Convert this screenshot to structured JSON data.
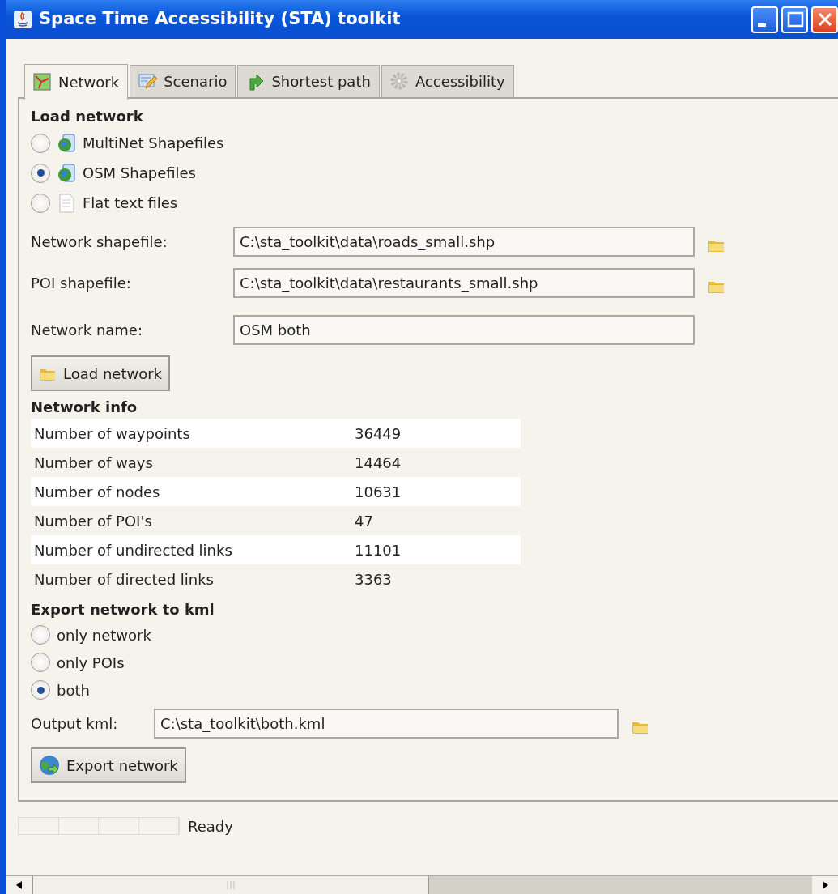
{
  "window": {
    "title": "Space Time Accessibility (STA) toolkit"
  },
  "tabs": [
    {
      "label": "Network",
      "selected": true
    },
    {
      "label": "Scenario",
      "selected": false
    },
    {
      "label": "Shortest path",
      "selected": false
    },
    {
      "label": "Accessibility",
      "selected": false
    }
  ],
  "load_network": {
    "heading": "Load network",
    "sources": [
      {
        "label": "MultiNet Shapefiles",
        "selected": false,
        "kind": "globe"
      },
      {
        "label": "OSM Shapefiles",
        "selected": true,
        "kind": "globe"
      },
      {
        "label": "Flat text files",
        "selected": false,
        "kind": "document"
      }
    ],
    "fields": [
      {
        "label": "Network shapefile:",
        "value": "C:\\sta_toolkit\\data\\roads_small.shp",
        "browse": true
      },
      {
        "label": "POI shapefile:",
        "value": "C:\\sta_toolkit\\data\\restaurants_small.shp",
        "browse": true
      },
      {
        "label": "Network name:",
        "value": "OSM both",
        "browse": false
      }
    ],
    "button": "Load network"
  },
  "network_info": {
    "heading": "Network info",
    "rows": [
      {
        "label": "Number of waypoints",
        "value": "36449"
      },
      {
        "label": "Number of ways",
        "value": "14464"
      },
      {
        "label": "Number of nodes",
        "value": "10631"
      },
      {
        "label": "Number of POI's",
        "value": "47"
      },
      {
        "label": "Number of undirected links",
        "value": "11101"
      },
      {
        "label": "Number of directed links",
        "value": "3363"
      }
    ]
  },
  "export": {
    "heading": "Export network to kml",
    "options": [
      {
        "label": "only network",
        "selected": false
      },
      {
        "label": "only POIs",
        "selected": false
      },
      {
        "label": "both",
        "selected": true
      }
    ],
    "field": {
      "label": "Output kml:",
      "value": "C:\\sta_toolkit\\both.kml",
      "browse": true
    },
    "button": "Export network"
  },
  "status_bar": {
    "text": "Ready"
  }
}
